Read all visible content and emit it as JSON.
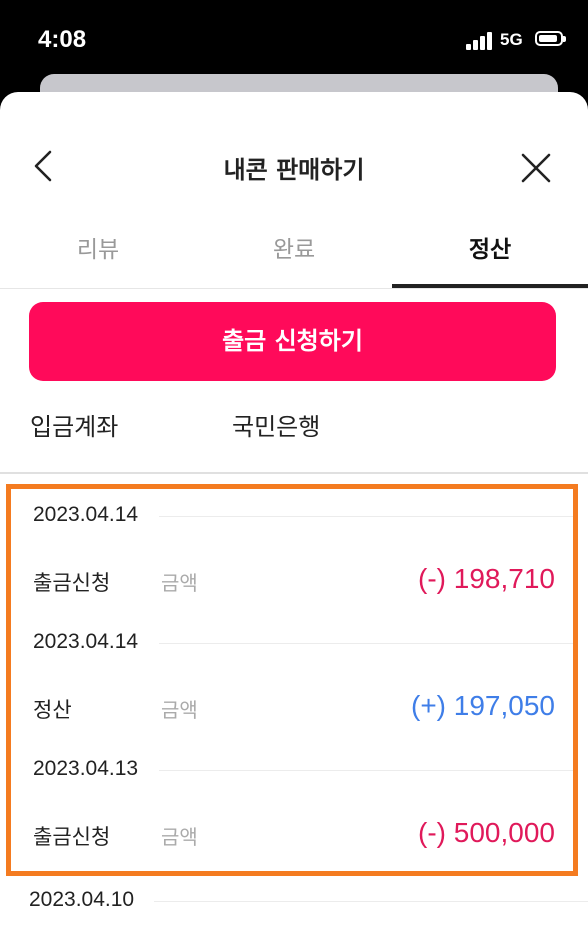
{
  "status_bar": {
    "time": "4:08",
    "network": "5G"
  },
  "header": {
    "title": "내콘 판매하기"
  },
  "tabs": [
    {
      "label": "리뷰",
      "active": false
    },
    {
      "label": "완료",
      "active": false
    },
    {
      "label": "정산",
      "active": true
    }
  ],
  "withdraw_button": {
    "label": "출금 신청하기"
  },
  "account": {
    "label": "입금계좌",
    "value": "국민은행"
  },
  "history": [
    {
      "date": "2023.04.14",
      "type": "출금신청",
      "amount_label": "금액",
      "amount": "(-) 198,710",
      "direction": "minus"
    },
    {
      "date": "2023.04.14",
      "type": "정산",
      "amount_label": "금액",
      "amount": "(+) 197,050",
      "direction": "plus"
    },
    {
      "date": "2023.04.13",
      "type": "출금신청",
      "amount_label": "금액",
      "amount": "(-) 500,000",
      "direction": "minus"
    }
  ],
  "trailing_date": "2023.04.10",
  "colors": {
    "accent": "#ff0a5a",
    "minus": "#e0195a",
    "plus": "#3f7ee8",
    "highlight_border": "#f47b20"
  },
  "icons": {
    "back": "chevron-left-icon",
    "close": "close-icon"
  }
}
